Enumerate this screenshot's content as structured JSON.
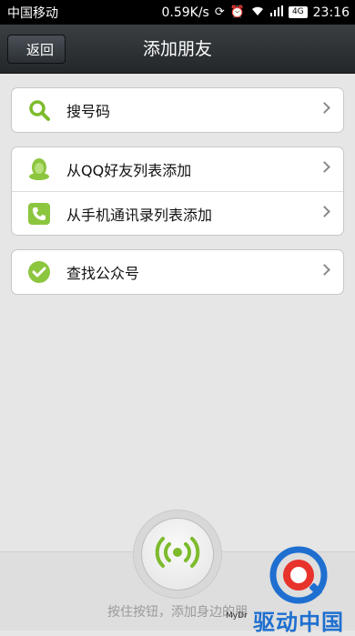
{
  "status_bar": {
    "carrier": "中国移动",
    "speed": "0.59K/s",
    "network": "4G",
    "time": "23:16"
  },
  "nav": {
    "back_label": "返回",
    "title": "添加朋友"
  },
  "menu": {
    "search_number": "搜号码",
    "qq_friends": "从QQ好友列表添加",
    "contacts": "从手机通讯录列表添加",
    "public_account": "查找公众号"
  },
  "radar": {
    "hint": "按住按钮，添加身边的朋"
  },
  "watermark": {
    "text": "驱动中国",
    "small": "MyDr"
  },
  "colors": {
    "accent_green": "#8cc63f",
    "nav_bg": "#2b2f33"
  },
  "icons": [
    "search-icon",
    "qq-penguin-icon",
    "phone-icon",
    "check-circle-icon",
    "radar-signal-icon"
  ]
}
